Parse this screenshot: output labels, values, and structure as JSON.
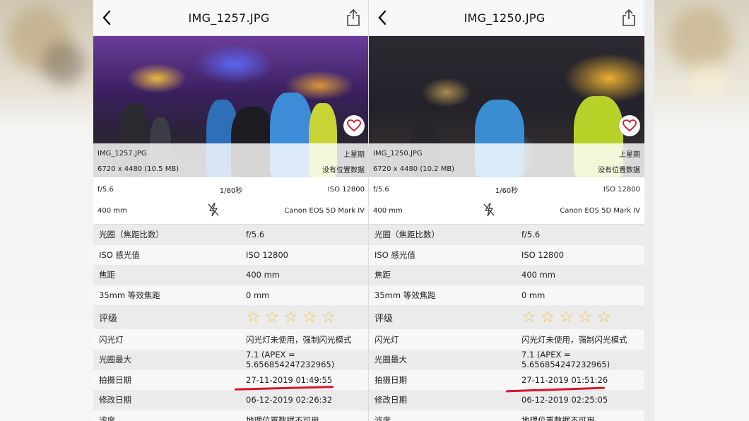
{
  "colors": {
    "accent_red": "#d8152a",
    "star": "#e9c646",
    "heart": "#d8152a"
  },
  "panels": [
    {
      "title": "IMG_1257.JPG",
      "overlay": {
        "filename": "IMG_1257.JPG",
        "when": "上星期",
        "dimensions": "6720 x 4480 (10.5 MB)",
        "location": "没有位置数据"
      },
      "summary": {
        "aperture": "f/5.6",
        "shutter": "1/80秒",
        "iso": "ISO 12800",
        "focal": "400 mm",
        "camera": "Canon EOS 5D Mark IV"
      },
      "rows": [
        {
          "k": "光圈（焦距比数）",
          "v": "f/5.6"
        },
        {
          "k": "ISO 感光值",
          "v": "ISO 12800"
        },
        {
          "k": "焦距",
          "v": "400 mm"
        },
        {
          "k": "35mm 等效焦距",
          "v": "0 mm"
        },
        {
          "k": "评级",
          "v": ""
        },
        {
          "k": "闪光灯",
          "v": "闪光灯未使用，强制闪光模式"
        },
        {
          "k": "光圈最大",
          "v": "7.1 (APEX = 5.656854247232965)"
        },
        {
          "k": "拍摄日期",
          "v": "27-11-2019 01:49:55"
        },
        {
          "k": "修改日期",
          "v": "06-12-2019 02:26:32"
        },
        {
          "k": "滤席",
          "v": "地理位置数据不可用"
        }
      ],
      "rating": 0
    },
    {
      "title": "IMG_1250.JPG",
      "overlay": {
        "filename": "IMG_1250.JPG",
        "when": "上星期",
        "dimensions": "6720 x 4480 (10.2 MB)",
        "location": "没有位置数据"
      },
      "summary": {
        "aperture": "f/5.6",
        "shutter": "1/60秒",
        "iso": "ISO 12800",
        "focal": "400 mm",
        "camera": "Canon EOS 5D Mark IV"
      },
      "rows": [
        {
          "k": "光圈（焦距比数）",
          "v": "f/5.6"
        },
        {
          "k": "ISO 感光值",
          "v": "ISO 12800"
        },
        {
          "k": "焦距",
          "v": "400 mm"
        },
        {
          "k": "35mm 等效焦距",
          "v": "0 mm"
        },
        {
          "k": "评级",
          "v": ""
        },
        {
          "k": "闪光灯",
          "v": "闪光灯未使用，强制闪光模式"
        },
        {
          "k": "光圈最大",
          "v": "7.1 (APEX = 5.656854247232965)"
        },
        {
          "k": "拍摄日期",
          "v": "27-11-2019 01:51:26"
        },
        {
          "k": "修改日期",
          "v": "06-12-2019 02:25:05"
        },
        {
          "k": "滤席",
          "v": "地理位置数据不可用"
        }
      ],
      "rating": 0
    }
  ],
  "icons": {
    "back": "chevron-left-icon",
    "share": "share-icon",
    "favorite": "heart-icon",
    "flash": "flash-off-icon",
    "star": "star-outline-icon"
  }
}
